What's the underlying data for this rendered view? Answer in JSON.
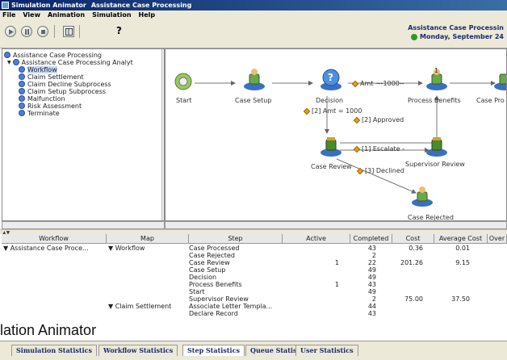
{
  "window": {
    "title": "Simulation Animator",
    "subtitle": "Assistance Case Processing"
  },
  "menu": [
    "File",
    "View",
    "Animation",
    "Simulation",
    "Help"
  ],
  "toolbar": {
    "help_label": "?",
    "app_name": "Assistance Case Processin",
    "date": "Monday, September 24"
  },
  "tree": {
    "items": [
      {
        "label": "Assistance Case Processing",
        "level": 0
      },
      {
        "label": "Assistance Case Processing Analyt",
        "level": 1
      },
      {
        "label": "Workflow",
        "level": 2,
        "selected": true
      },
      {
        "label": "Claim Settlement",
        "level": 2
      },
      {
        "label": "Claim Decline Subprocess",
        "level": 2
      },
      {
        "label": "Claim Setup Subprocess",
        "level": 2
      },
      {
        "label": "Malfunction",
        "level": 2
      },
      {
        "label": "Risk Assessment",
        "level": 2
      },
      {
        "label": "Terminate",
        "level": 2
      }
    ]
  },
  "diagram": {
    "nodes": {
      "start": "Start",
      "case_setup": "Case Setup",
      "decision": "Decision",
      "process_benefits": "Process Benefits",
      "case_pro": "Case Pro",
      "case_review": "Case Review",
      "supervisor_review": "Supervisor Review",
      "case_rejected": "Case Rejected"
    },
    "edges": {
      "amt_gt": "Amt ~-1000--",
      "amt_eq": "[2] Amt = 1000",
      "approved": "[2] Approved",
      "escalate": "[1] Escalate -",
      "declined": "[3] Declined",
      "count_one": "1"
    }
  },
  "table": {
    "columns": [
      "Workflow",
      "Map",
      "Step",
      "Active",
      "Completed",
      "Cost",
      "Average Cost",
      "Over"
    ],
    "rows": [
      {
        "workflow": "▼ Assistance Case Proce...",
        "map": "▼ Workflow",
        "step": "Case Processed",
        "active": "",
        "completed": "43",
        "cost": "0.36",
        "avg": "0.01"
      },
      {
        "workflow": "",
        "map": "",
        "step": "Case Rejected",
        "active": "",
        "completed": "2",
        "cost": "",
        "avg": ""
      },
      {
        "workflow": "",
        "map": "",
        "step": "Case Review",
        "active": "1",
        "completed": "22",
        "cost": "201.26",
        "avg": "9.15"
      },
      {
        "workflow": "",
        "map": "",
        "step": "Case Setup",
        "active": "",
        "completed": "49",
        "cost": "",
        "avg": ""
      },
      {
        "workflow": "",
        "map": "",
        "step": "Decision",
        "active": "",
        "completed": "49",
        "cost": "",
        "avg": ""
      },
      {
        "workflow": "",
        "map": "",
        "step": "Process Benefits",
        "active": "1",
        "completed": "43",
        "cost": "",
        "avg": ""
      },
      {
        "workflow": "",
        "map": "",
        "step": "Start",
        "active": "",
        "completed": "49",
        "cost": "",
        "avg": ""
      },
      {
        "workflow": "",
        "map": "",
        "step": "Supervisor Review",
        "active": "",
        "completed": "2",
        "cost": "75.00",
        "avg": "37.50"
      },
      {
        "workflow": "",
        "map": "▼ Claim Settlement",
        "step": "Associate Letter Templa...",
        "active": "",
        "completed": "44",
        "cost": "",
        "avg": ""
      },
      {
        "workflow": "",
        "map": "",
        "step": "Declare Record",
        "active": "",
        "completed": "43",
        "cost": "",
        "avg": ""
      }
    ]
  },
  "overlay_label": "lation Animator",
  "tabs": [
    "Simulation Statistics",
    "Workflow Statistics",
    "Step Statistics",
    "Queue Statistics",
    "User Statistics"
  ],
  "active_tab": "Step Statistics",
  "colors": {
    "titlebar": "#0a246a",
    "accent": "#1a2a6c",
    "status_green": "#2a9a2a"
  }
}
